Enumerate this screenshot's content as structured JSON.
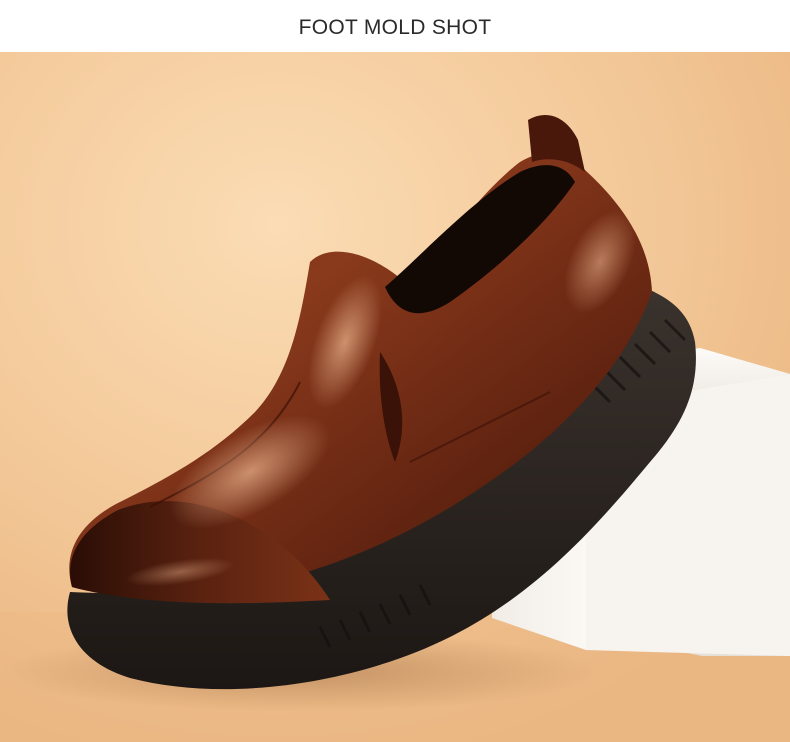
{
  "header": {
    "title": "FOOT MOLD SHOT"
  },
  "photo": {
    "subject": "brown-leather-slip-on-shoe-icon",
    "colors": {
      "background": "#f2c99a",
      "leather": "#6e2a14",
      "sole": "#2b2420",
      "block": "#f6f2ee"
    }
  }
}
